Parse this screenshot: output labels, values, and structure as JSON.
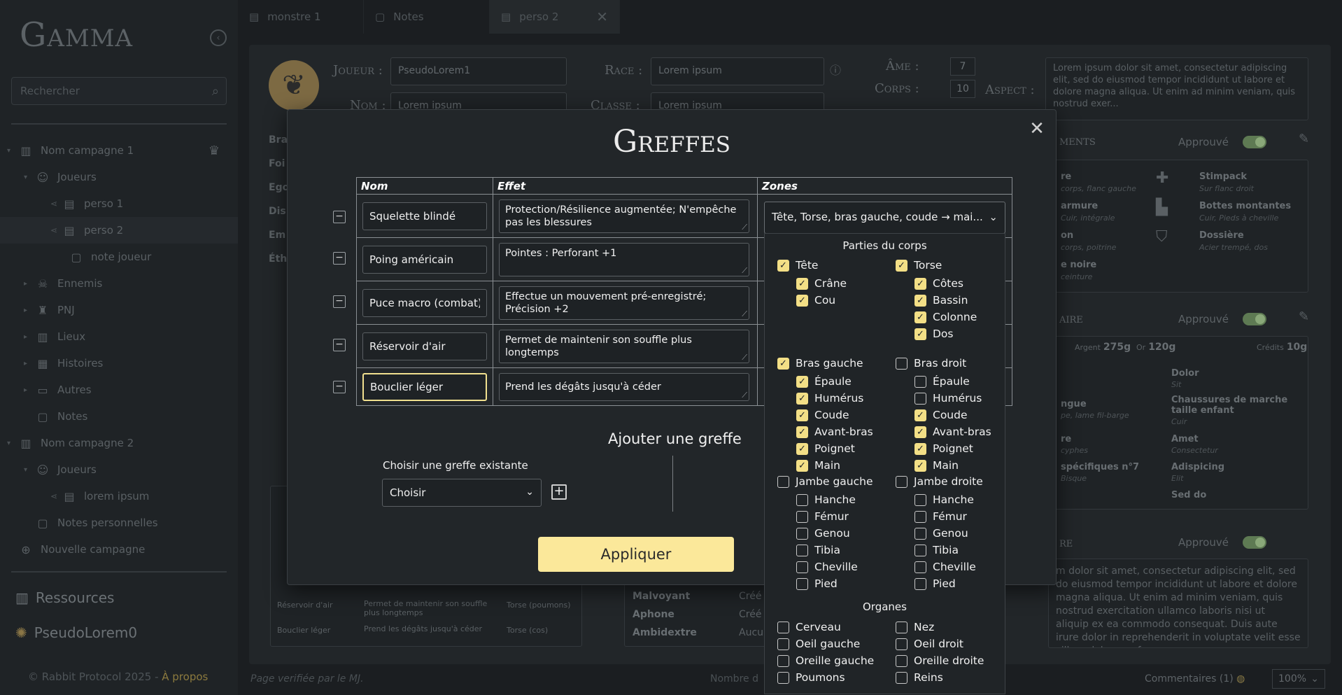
{
  "sidebar": {
    "logo": "Gamma",
    "search_placeholder": "Rechercher",
    "tree": [
      {
        "label": "Nom campagne 1",
        "level": 0,
        "icon": "map-icon",
        "toggle": "▾",
        "crown": true
      },
      {
        "label": "Joueurs",
        "level": 1,
        "icon": "users-icon",
        "toggle": "▾"
      },
      {
        "label": "perso 1",
        "level": 2,
        "icon": "character-sheet-icon",
        "toggle": ""
      },
      {
        "label": "perso 2",
        "level": 2,
        "icon": "character-sheet-icon",
        "toggle": "",
        "active": true
      },
      {
        "label": "note joueur",
        "level": 3,
        "icon": "note-icon",
        "toggle": ""
      },
      {
        "label": "Ennemis",
        "level": 1,
        "icon": "enemy-icon",
        "toggle": "▸"
      },
      {
        "label": "PNJ",
        "level": 1,
        "icon": "npc-icon",
        "toggle": "▸"
      },
      {
        "label": "Lieux",
        "level": 1,
        "icon": "map-icon",
        "toggle": "▸"
      },
      {
        "label": "Histoires",
        "level": 1,
        "icon": "book-icon",
        "toggle": "▸"
      },
      {
        "label": "Autres",
        "level": 1,
        "icon": "folder-icon",
        "toggle": "▸"
      },
      {
        "label": "Notes",
        "level": 1,
        "icon": "note-icon",
        "toggle": ""
      },
      {
        "label": "Nom campagne 2",
        "level": 0,
        "icon": "map-icon",
        "toggle": "▾"
      },
      {
        "label": "Joueurs",
        "level": 1,
        "icon": "users-icon",
        "toggle": "▾"
      },
      {
        "label": "lorem ipsum",
        "level": 2,
        "icon": "character-sheet-icon",
        "toggle": ""
      },
      {
        "label": "Notes personnelles",
        "level": 1,
        "icon": "note-icon",
        "toggle": ""
      },
      {
        "label": "Nouvelle campagne",
        "level": 0,
        "icon": "plus-circle-icon",
        "toggle": ""
      }
    ],
    "resources_label": "Ressources",
    "user_label": "PseudoLorem0",
    "footer_text": "© Rabbit Protocol 2025 - ",
    "footer_link": "À propos"
  },
  "tabs": [
    {
      "label": "monstre 1",
      "icon": "character-sheet-icon"
    },
    {
      "label": "Notes",
      "icon": "note-icon"
    },
    {
      "label": "perso 2",
      "icon": "character-sheet-icon",
      "active": true
    }
  ],
  "background": {
    "joueur_label": "Joueur :",
    "joueur_value": "PseudoLorem1",
    "nom_label": "Nom :",
    "nom_value": "Lorem ipsum",
    "race_label": "Race :",
    "race_value": "Lorem ipsum",
    "classe_label": "Classe :",
    "classe_value": "Lorem ipsum",
    "ame_label": "Âme :",
    "ame_value": "7",
    "corps_label": "Corps :",
    "corps_value": "10",
    "aspect_label": "Aspect :",
    "aspect_text": "Lorem ipsum dolor sit amet, consectetur adipiscing elit, sed do eiusmod tempor incididunt ut labore et dolore magna aliqua. Ut enim ad minim veniam, quis nostrud exer...",
    "left_rows": [
      "Bra",
      "Foi",
      "Ego",
      "Dis",
      "Em",
      "Éth"
    ],
    "equip_heading": "ments",
    "approved_label": "Approuvé",
    "equip_items": [
      {
        "name": "re",
        "sub": "corps, flanc gauche"
      },
      {
        "name": "Stimpack",
        "sub": "Sur flanc droit"
      },
      {
        "name": "armure",
        "sub": "Cuir, intégrale"
      },
      {
        "name": "Bottes montantes",
        "sub": "Cuir, Pieds à cheville"
      },
      {
        "name": "on",
        "sub": "corps, poitrine"
      },
      {
        "name": "Dossière",
        "sub": "Acier trempé, dos"
      },
      {
        "name": "e noire",
        "sub": "ceinture"
      }
    ],
    "inv_heading": "aire",
    "inv_money": [
      {
        "label": "Argent",
        "value": "275g"
      },
      {
        "label": "Or",
        "value": "120g"
      },
      {
        "label": "Crédits",
        "value": "10g"
      }
    ],
    "inv_items": [
      {
        "name": "Dolor",
        "sub": "Sit"
      },
      {
        "name": "ngue",
        "sub": "pe, lame fil-barge"
      },
      {
        "name": "Chaussures de marche taille enfant",
        "sub": "Cuir"
      },
      {
        "name": "re",
        "sub": "cyphes"
      },
      {
        "name": "Amet",
        "sub": "Consectetur"
      },
      {
        "name": "spécifiques n°7",
        "sub": "Bisque"
      },
      {
        "name": "Adispicing",
        "sub": "Elit"
      },
      {
        "name": "Sed do",
        "sub": ""
      }
    ],
    "story_heading": "re",
    "story_text": "m dolor sit amet, consectetur adipiscing elit, sed do eiusmod tempor incididunt ut labore et dolore magna aliqua. Ut enim ad minim veniam, quis nostrud exercitation ullamco laboris nisi ut aliquip ex ea commodo consequat. Duis aute irure dolor in reprehenderit in voluptate velit esse cillum dolore eu f...",
    "mini_rows": [
      {
        "a": "Réservoir d'air",
        "b": "Permet de maintenir son souffle plus longtemps",
        "c": "Torse (poumons)"
      },
      {
        "a": "Bouclier léger",
        "b": "Prend les dégâts jusqu'à céder",
        "c": "Torse (cos)"
      }
    ],
    "traits": [
      {
        "name": "Malvoyant",
        "val": "Créé"
      },
      {
        "name": "Aphone",
        "val": "Créé"
      },
      {
        "name": "Ambidextre",
        "val": "Aucu"
      }
    ],
    "status_left": "Page verifiée par le MJ.",
    "status_mid": "Nombre d",
    "comments_label": "Commentaires (1)",
    "zoom": "100%"
  },
  "modal": {
    "title": "Greffes",
    "columns": {
      "nom": "Nom",
      "effet": "Effet",
      "zones": "Zones"
    },
    "grafts": [
      {
        "name": "Squelette blindé",
        "effect": "Protection/Résilience augmentée; N'empêche pas les blessures"
      },
      {
        "name": "Poing américain",
        "effect": "Pointes : Perforant +1"
      },
      {
        "name": "Puce macro (combat)",
        "effect": "Effectue un mouvement pré-enregistré; Précision +2"
      },
      {
        "name": "Réservoir d'air",
        "effect": "Permet de maintenir son souffle plus longtemps"
      },
      {
        "name": "Bouclier léger",
        "effect": "Prend les dégâts jusqu'à céder"
      }
    ],
    "zones_value": "Tête, Torse, bras gauche, coude → mai...",
    "add_title": "Ajouter une greffe",
    "existing_label": "Choisir une greffe existante",
    "existing_value": "Choisir",
    "apply_label": "Appliquer"
  },
  "dropdown": {
    "section_body": "Parties du corps",
    "section_organs": "Organes",
    "groups": [
      {
        "col": 0,
        "label": "Tête",
        "checked": true,
        "items": [
          {
            "label": "Crâne",
            "checked": true
          },
          {
            "label": "Cou",
            "checked": true
          }
        ]
      },
      {
        "col": 1,
        "label": "Torse",
        "checked": true,
        "items": [
          {
            "label": "Côtes",
            "checked": true
          },
          {
            "label": "Bassin",
            "checked": true
          },
          {
            "label": "Colonne",
            "checked": true
          },
          {
            "label": "Dos",
            "checked": true
          }
        ]
      },
      {
        "col": 0,
        "label": "Bras gauche",
        "checked": true,
        "items": [
          {
            "label": "Épaule",
            "checked": true
          },
          {
            "label": "Humérus",
            "checked": true
          },
          {
            "label": "Coude",
            "checked": true
          },
          {
            "label": "Avant-bras",
            "checked": true
          },
          {
            "label": "Poignet",
            "checked": true
          },
          {
            "label": "Main",
            "checked": true
          }
        ]
      },
      {
        "col": 1,
        "label": "Bras droit",
        "checked": false,
        "items": [
          {
            "label": "Épaule",
            "checked": false
          },
          {
            "label": "Humérus",
            "checked": false
          },
          {
            "label": "Coude",
            "checked": true
          },
          {
            "label": "Avant-bras",
            "checked": true
          },
          {
            "label": "Poignet",
            "checked": true
          },
          {
            "label": "Main",
            "checked": true
          }
        ]
      },
      {
        "col": 0,
        "label": "Jambe gauche",
        "checked": false,
        "items": [
          {
            "label": "Hanche",
            "checked": false
          },
          {
            "label": "Fémur",
            "checked": false
          },
          {
            "label": "Genou",
            "checked": false
          },
          {
            "label": "Tibia",
            "checked": false
          },
          {
            "label": "Cheville",
            "checked": false
          },
          {
            "label": "Pied",
            "checked": false
          }
        ]
      },
      {
        "col": 1,
        "label": "Jambe droite",
        "checked": false,
        "items": [
          {
            "label": "Hanche",
            "checked": false
          },
          {
            "label": "Fémur",
            "checked": false
          },
          {
            "label": "Genou",
            "checked": false
          },
          {
            "label": "Tibia",
            "checked": false
          },
          {
            "label": "Cheville",
            "checked": false
          },
          {
            "label": "Pied",
            "checked": false
          }
        ]
      }
    ],
    "organs": [
      {
        "label": "Cerveau",
        "checked": false
      },
      {
        "label": "Nez",
        "checked": false
      },
      {
        "label": "Oeil gauche",
        "checked": false
      },
      {
        "label": "Oeil droit",
        "checked": false
      },
      {
        "label": "Oreille gauche",
        "checked": false
      },
      {
        "label": "Oreille droite",
        "checked": false
      },
      {
        "label": "Poumons",
        "checked": false
      },
      {
        "label": "Reins",
        "checked": false
      }
    ]
  }
}
